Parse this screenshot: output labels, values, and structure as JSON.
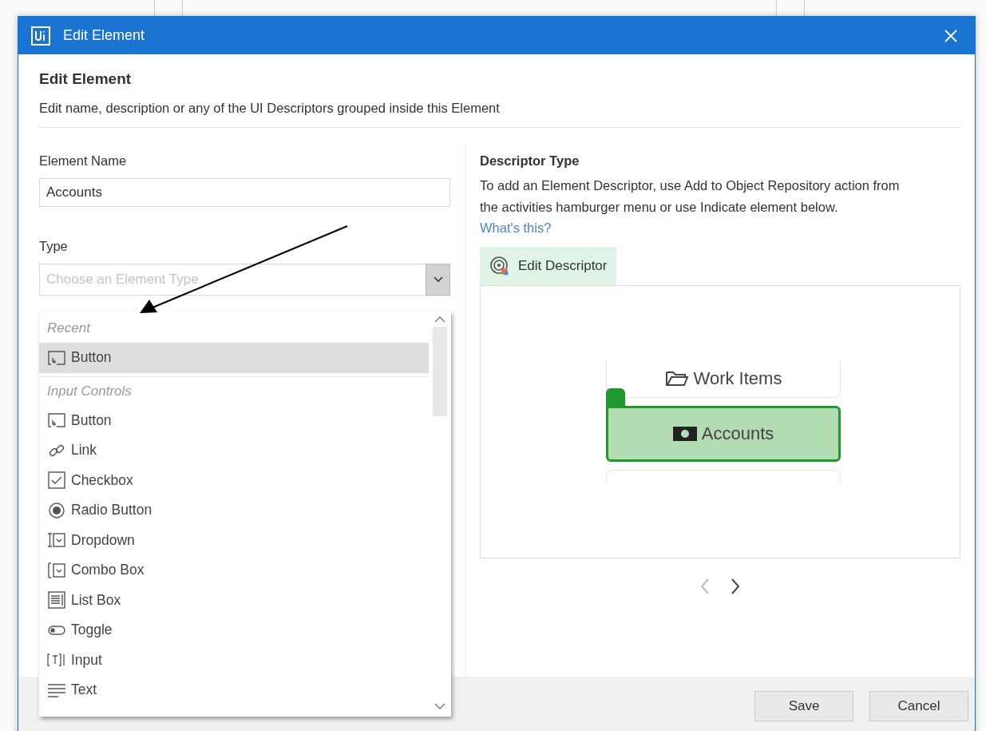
{
  "window": {
    "title": "Edit Element"
  },
  "header": {
    "title": "Edit Element",
    "description": "Edit name, description or any of the UI Descriptors grouped inside this Element"
  },
  "form": {
    "name_label": "Element Name",
    "name_value": "Accounts",
    "type_label": "Type",
    "type_placeholder": "Choose an Element Type"
  },
  "dropdown": {
    "groups": [
      {
        "label": "Recent",
        "items": [
          {
            "label": "Button",
            "kind": "button",
            "selected": true
          }
        ]
      },
      {
        "label": "Input Controls",
        "items": [
          {
            "label": "Button",
            "kind": "button",
            "selected": false
          },
          {
            "label": "Link",
            "kind": "link",
            "selected": false
          },
          {
            "label": "Checkbox",
            "kind": "checkbox",
            "selected": false
          },
          {
            "label": "Radio Button",
            "kind": "radio",
            "selected": false
          },
          {
            "label": "Dropdown",
            "kind": "dropdown",
            "selected": false
          },
          {
            "label": "Combo Box",
            "kind": "combo",
            "selected": false
          },
          {
            "label": "List Box",
            "kind": "listbox",
            "selected": false
          },
          {
            "label": "Toggle",
            "kind": "toggle",
            "selected": false
          },
          {
            "label": "Input",
            "kind": "input",
            "selected": false
          },
          {
            "label": "Text",
            "kind": "text",
            "selected": false
          }
        ]
      }
    ]
  },
  "descriptor": {
    "title": "Descriptor Type",
    "text": "To add an Element Descriptor, use Add to Object Repository action from the activities hamburger menu or use Indicate element below.",
    "link": "What's this?",
    "edit_button": "Edit Descriptor",
    "preview": [
      {
        "label": "Work Items",
        "kind": "folder",
        "selected": false
      },
      {
        "label": "Accounts",
        "kind": "money",
        "selected": true
      },
      {
        "kind": "empty",
        "selected": false
      }
    ]
  },
  "buttons": [
    "Save",
    "Cancel"
  ]
}
